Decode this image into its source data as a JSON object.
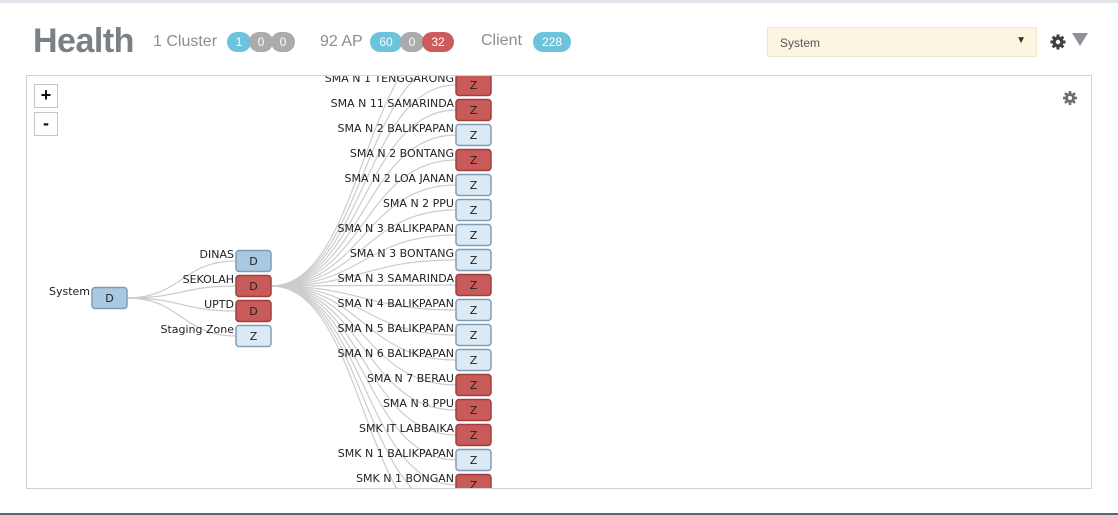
{
  "header": {
    "title": "Health",
    "cluster": {
      "label": "1 Cluster",
      "counts": [
        "1",
        "0",
        "0"
      ]
    },
    "ap": {
      "label": "92 AP",
      "counts": [
        "60",
        "0",
        "32"
      ]
    },
    "client": {
      "label": "Client",
      "count": "228"
    },
    "system_select": {
      "value": "System"
    },
    "icons": {
      "settings": "gear-icon",
      "filter": "filter-triangle-icon"
    }
  },
  "panel": {
    "zoom_in": "+",
    "zoom_out": "-",
    "icons": {
      "settings": "gear-icon"
    }
  },
  "tree": {
    "root": {
      "label": "System",
      "box": "D",
      "status": "ok"
    },
    "groups": [
      {
        "label": "DINAS",
        "box": "D",
        "status": "ok"
      },
      {
        "label": "SEKOLAH",
        "box": "D",
        "status": "alert"
      },
      {
        "label": "UPTD",
        "box": "D",
        "status": "alert"
      },
      {
        "label": "Staging Zone",
        "box": "Z",
        "status": "neutral"
      }
    ],
    "zones": [
      {
        "label": "SMA N 1 TENGGARONG",
        "box": "Z",
        "status": "alert"
      },
      {
        "label": "SMA N 11 SAMARINDA",
        "box": "Z",
        "status": "alert"
      },
      {
        "label": "SMA N 2 BALIKPAPAN",
        "box": "Z",
        "status": "neutral"
      },
      {
        "label": "SMA N 2 BONTANG",
        "box": "Z",
        "status": "alert"
      },
      {
        "label": "SMA N 2 LOA JANAN",
        "box": "Z",
        "status": "neutral"
      },
      {
        "label": "SMA N 2 PPU",
        "box": "Z",
        "status": "neutral"
      },
      {
        "label": "SMA N 3 BALIKPAPAN",
        "box": "Z",
        "status": "neutral"
      },
      {
        "label": "SMA N 3 BONTANG",
        "box": "Z",
        "status": "neutral"
      },
      {
        "label": "SMA N 3 SAMARINDA",
        "box": "Z",
        "status": "alert"
      },
      {
        "label": "SMA N 4 BALIKPAPAN",
        "box": "Z",
        "status": "neutral"
      },
      {
        "label": "SMA N 5 BALIKPAPAN",
        "box": "Z",
        "status": "neutral"
      },
      {
        "label": "SMA N 6 BALIKPAPAN",
        "box": "Z",
        "status": "neutral"
      },
      {
        "label": "SMA N 7 BERAU",
        "box": "Z",
        "status": "alert"
      },
      {
        "label": "SMA N 8 PPU",
        "box": "Z",
        "status": "alert"
      },
      {
        "label": "SMK IT LABBAIKA",
        "box": "Z",
        "status": "alert"
      },
      {
        "label": "SMK N 1 BALIKPAPAN",
        "box": "Z",
        "status": "neutral"
      },
      {
        "label": "SMK N 1 BONGAN",
        "box": "Z",
        "status": "alert"
      }
    ]
  },
  "colors": {
    "ok": "#a9c8e2",
    "alert": "#c95a5a",
    "neutral": "#dceaf6",
    "link": "#cccccc",
    "pill_blue": "#6ec3dc",
    "pill_gray": "#a9abad",
    "pill_red": "#cc5b5b"
  }
}
